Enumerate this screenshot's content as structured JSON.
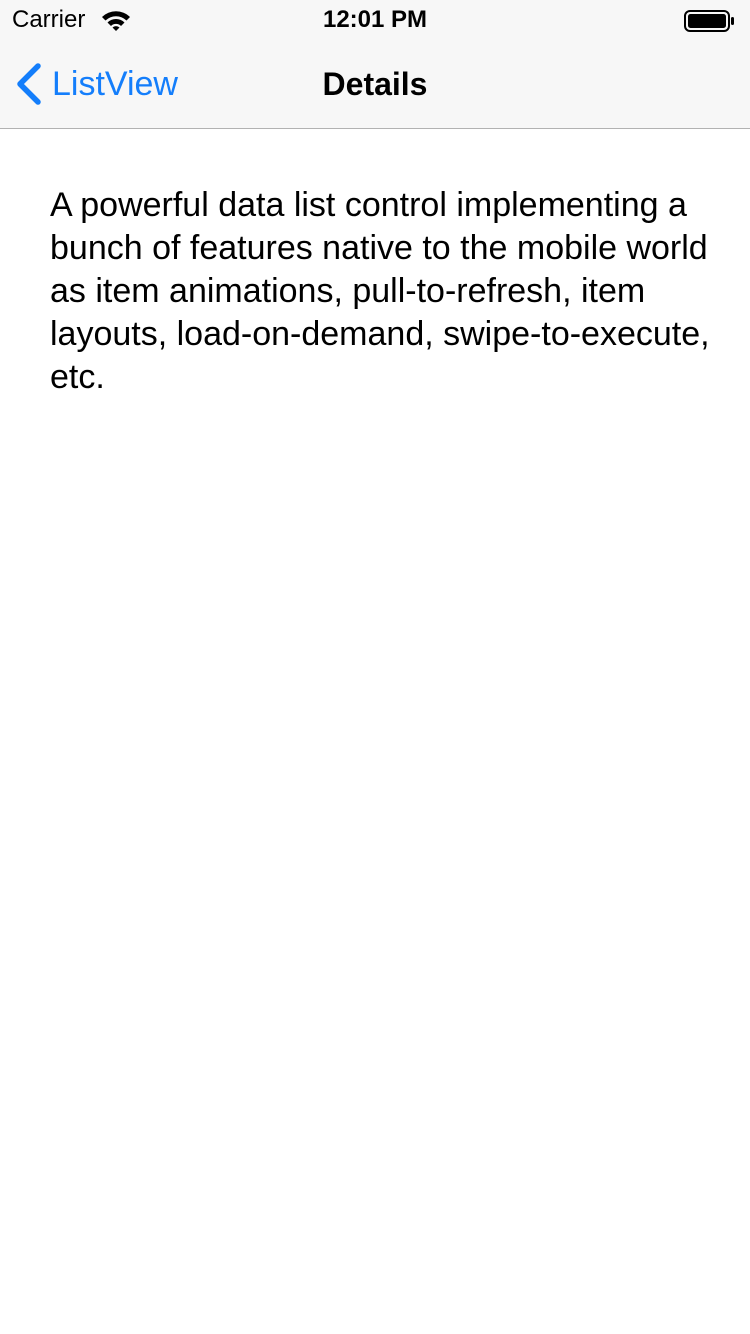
{
  "status_bar": {
    "carrier": "Carrier",
    "time": "12:01 PM",
    "icons": [
      "wifi-icon",
      "battery-icon"
    ]
  },
  "nav_bar": {
    "back_label": "ListView",
    "title": "Details",
    "accent_color": "#147efb"
  },
  "content": {
    "description": "A powerful data list control implementing a bunch of features native to the mobile world as item animations, pull-to-refresh, item layouts, load-on-demand, swipe-to-execute, etc."
  }
}
